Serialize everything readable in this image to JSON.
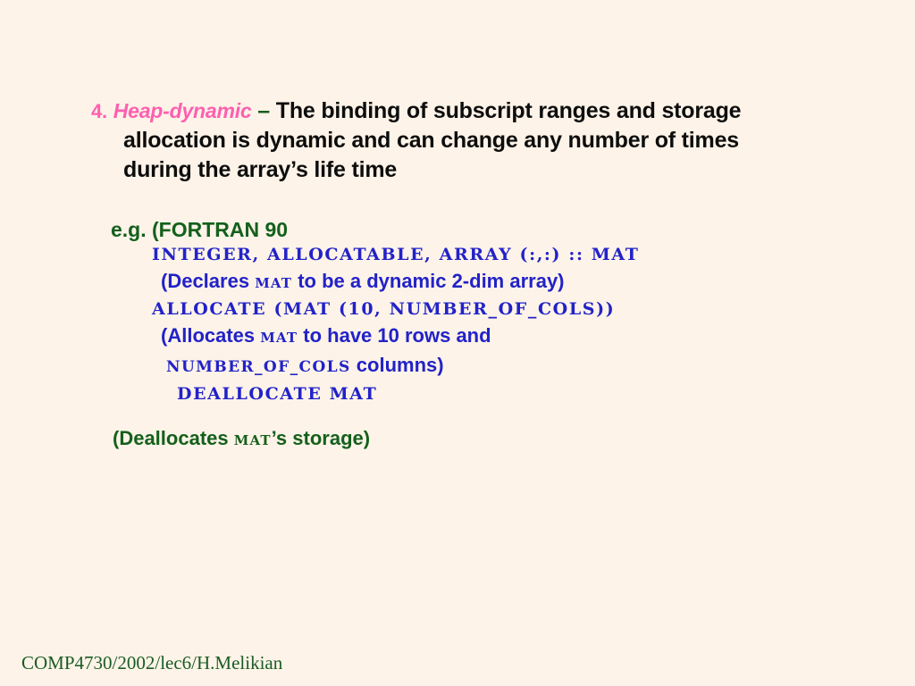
{
  "slide": {
    "background_color": "#fdf3e8",
    "bullet": {
      "number": "4.",
      "term": "Heap-dynamic",
      "dash": "–",
      "line1_rest": "The binding of subscript ranges and storage",
      "line2": "allocation is dynamic and can change any number of times",
      "line3": "during the array’s life time",
      "number_color": "#ff5fb0",
      "term_color": "#ff5fb0",
      "dash_color": "#1a5c1e",
      "body_color": "#0d0d0d"
    },
    "example": {
      "heading": "e.g. (FORTRAN 90",
      "heading_color": "#14601c",
      "code_color": "#2222c8",
      "lines": [
        {
          "kind": "code",
          "indent": "i1",
          "text": "INTEGER, ALLOCATABLE, ARRAY (:,:) :: MAT"
        },
        {
          "kind": "gloss",
          "indent": "g1",
          "prefix": "(Declares ",
          "mono": "MAT",
          "suffix": " to be a dynamic 2-dim array)"
        },
        {
          "kind": "code",
          "indent": "i2",
          "text": "ALLOCATE (MAT (10, NUMBER_OF_COLS))"
        },
        {
          "kind": "gloss",
          "indent": "g2",
          "prefix": "(Allocates ",
          "mono": "MAT",
          "suffix": " to have 10 rows and"
        },
        {
          "kind": "mixed",
          "indent": "i3",
          "code_seg": "NUMBER_OF_COLS",
          "word_seg": "  columns)"
        },
        {
          "kind": "code",
          "indent": "i4",
          "text": "DEALLOCATE MAT"
        }
      ]
    },
    "closing": {
      "prefix": "(Deallocates ",
      "mono": "MAT",
      "suffix": "’s storage)",
      "color": "#14601c"
    },
    "footer": {
      "text": "COMP4730/2002/lec6/H.Melikian",
      "color": "#1a5c23"
    }
  }
}
